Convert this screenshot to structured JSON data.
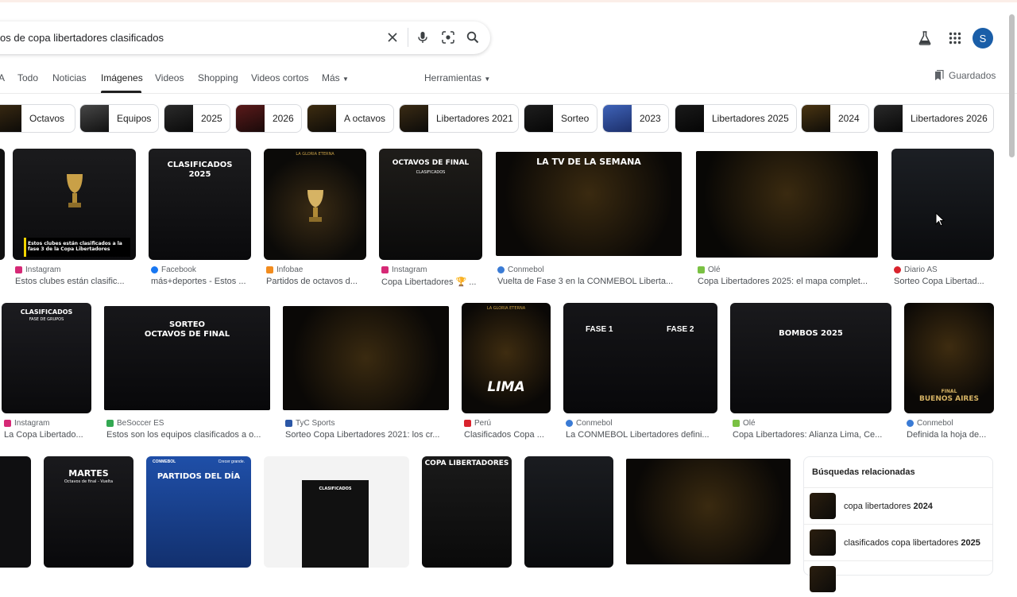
{
  "search": {
    "query": "os de copa libertadores clasificados"
  },
  "header": {
    "avatar_letter": "S"
  },
  "tabs": [
    {
      "label": "A",
      "active": false
    },
    {
      "label": "Todo",
      "active": false
    },
    {
      "label": "Noticias",
      "active": false
    },
    {
      "label": "Imágenes",
      "active": true
    },
    {
      "label": "Videos",
      "active": false
    },
    {
      "label": "Shopping",
      "active": false
    },
    {
      "label": "Videos cortos",
      "active": false
    },
    {
      "label": "Más",
      "active": false
    }
  ],
  "tools_label": "Herramientas",
  "saved_label": "Guardados",
  "chips": [
    {
      "label": "Octavos"
    },
    {
      "label": "Equipos"
    },
    {
      "label": "2025"
    },
    {
      "label": "2026"
    },
    {
      "label": "A octavos"
    },
    {
      "label": "Libertadores 2021"
    },
    {
      "label": "Sorteo"
    },
    {
      "label": "2023"
    },
    {
      "label": "Libertadores 2025"
    },
    {
      "label": "2024"
    },
    {
      "label": "Libertadores 2026"
    }
  ],
  "results_row1": [
    {
      "source": "Instagram",
      "title": "Estos clubes están clasific...",
      "thumb_caption": "Estos clubes están clasificados a la fase 3 de la Copa Libertadores"
    },
    {
      "source": "Facebook",
      "title": "más+deportes - Estos ...",
      "thumb_heading": "CLASIFICADOS",
      "thumb_sub": "2025"
    },
    {
      "source": "Infobae",
      "title": "Partidos de octavos d...",
      "thumb_top": "LA GLORIA ETERNA"
    },
    {
      "source": "Instagram",
      "title": "Copa Libertadores 🏆 ...",
      "thumb_heading": "OCTAVOS DE FINAL",
      "thumb_sub": "CLASIFICADOS"
    },
    {
      "source": "Conmebol",
      "title": "Vuelta de Fase 3 en la CONMEBOL Liberta...",
      "thumb_heading": "LA TV DE LA SEMANA"
    },
    {
      "source": "Olé",
      "title": "Copa Libertadores 2025: el mapa complet..."
    },
    {
      "source": "Diario AS",
      "title": "Sorteo Copa Libertad..."
    }
  ],
  "results_row2": [
    {
      "source": "Instagram",
      "title": "La Copa Libertado...",
      "thumb_heading": "CLASIFICADOS",
      "thumb_sub": "FASE DE GRUPOS"
    },
    {
      "source": "BeSoccer ES",
      "title": "Estos son los equipos clasificados a o...",
      "thumb_heading": "SORTEO",
      "thumb_sub": "OCTAVOS DE FINAL"
    },
    {
      "source": "TyC Sports",
      "title": "Sorteo Copa Libertadores 2021: los cr..."
    },
    {
      "source": "Perú",
      "title": "Clasificados Copa ...",
      "thumb_heading": "LIMA",
      "thumb_top": "LA GLORIA ETERNA"
    },
    {
      "source": "Conmebol",
      "title": "La CONMEBOL Libertadores defini...",
      "thumb_heading": "FASE 1",
      "thumb_sub": "FASE 2"
    },
    {
      "source": "Olé",
      "title": "Copa Libertadores: Alianza Lima, Ce...",
      "thumb_heading": "BOMBOS 2025"
    },
    {
      "source": "Conmebol",
      "title": "Definida la hoja de...",
      "thumb_heading": "FINAL",
      "thumb_sub": "BUENOS AIRES"
    }
  ],
  "results_row3": [
    {
      "thumb_heading": "MARTES",
      "thumb_sub": "Octavos de final - Vuelta"
    },
    {
      "thumb_heading": "PARTIDOS DEL DÍA",
      "thumb_top": "CONMEBOL",
      "thumb_tag": "Crecer grande."
    },
    {
      "thumb_heading": "CLASIFICADOS"
    },
    {
      "thumb_heading": "COPA LIBERTADORES"
    },
    {},
    {}
  ],
  "related": {
    "title": "Búsquedas relacionadas",
    "items": [
      {
        "prefix": "copa libertadores ",
        "bold": "2024"
      },
      {
        "prefix": "clasificados copa libertadores ",
        "bold": "2025"
      }
    ]
  },
  "colors": {
    "accent_avatar": "#1a5ea8",
    "thumb_dark": "#0b0b0d",
    "gold": "#c9a047"
  }
}
